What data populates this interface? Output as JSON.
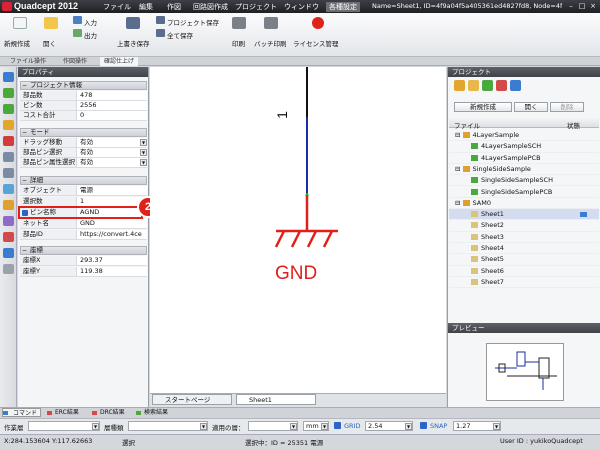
{
  "window": {
    "app_title": "Quadcept 2012",
    "menu": [
      "ファイル",
      "編集",
      "作図",
      "回路図作成",
      "プロジェクト",
      "ウィンドウ",
      "各種設定"
    ],
    "document_info": "Name=Sheet1, ID=4f9a04f5a405361ed4827fd8, Node=4f9a-..."
  },
  "ribbon": {
    "new_label": "新規作成",
    "open_label": "開く",
    "import_label": "入力",
    "export_label": "出力",
    "overwrite_save_label": "上書き保存",
    "project_save_label": "プロジェクト保存",
    "save_all_label": "全て保存",
    "print_label": "印刷",
    "batch_print_label": "バッチ印刷",
    "license_label": "ライセンス管理",
    "tabs": [
      "ファイル操作",
      "作図操作",
      "確認仕上げ"
    ]
  },
  "properties": {
    "panel_title": "プロパティ",
    "sections": {
      "project_info": "プロジェクト情報",
      "mode": "モード",
      "detail": "詳細",
      "coords": "座標"
    },
    "project_rows": [
      {
        "key": "部品数",
        "value": "478"
      },
      {
        "key": "ピン数",
        "value": "2556"
      },
      {
        "key": "コスト合計",
        "value": "0"
      }
    ],
    "mode_rows": [
      {
        "key": "ドラッグ移動",
        "value": "有効"
      },
      {
        "key": "部品ピン選択",
        "value": "有効"
      },
      {
        "key": "部品ピン属性選択",
        "value": "有効"
      }
    ],
    "detail_rows": [
      {
        "key": "オブジェクト",
        "value": "電源"
      },
      {
        "key": "選択数",
        "value": "1"
      },
      {
        "key": "ピン名称",
        "value": "AGND"
      },
      {
        "key": "ネット名",
        "value": "GND"
      },
      {
        "key": "部品ID",
        "value": "https://convert.4ce"
      }
    ],
    "coord_rows": [
      {
        "key": "座標X",
        "value": "293.37"
      },
      {
        "key": "座標Y",
        "value": "119.38"
      }
    ],
    "callout_number": "2"
  },
  "canvas": {
    "pin_number": "1",
    "net_label": "GND",
    "doc_tabs": [
      "スタートページ",
      "Sheet1"
    ]
  },
  "project": {
    "panel_title": "プロジェクト",
    "new_button": "新規作成",
    "open_button": "開く",
    "delete_button": "削除",
    "col_file": "ファイル",
    "col_status": "状態",
    "tree": [
      {
        "label": "4LayerSample",
        "level": 0,
        "kind": "project"
      },
      {
        "label": "4LayerSampleSCH",
        "level": 1,
        "kind": "sch"
      },
      {
        "label": "4LayerSamplePCB",
        "level": 1,
        "kind": "pcb"
      },
      {
        "label": "SingleSideSample",
        "level": 0,
        "kind": "project"
      },
      {
        "label": "SingleSideSampleSCH",
        "level": 1,
        "kind": "sch"
      },
      {
        "label": "SingleSideSamplePCB",
        "level": 1,
        "kind": "pcb"
      },
      {
        "label": "SAM0",
        "level": 0,
        "kind": "project"
      },
      {
        "label": "Sheet1",
        "level": 1,
        "kind": "sheet"
      },
      {
        "label": "Sheet2",
        "level": 1,
        "kind": "sheet"
      },
      {
        "label": "Sheet3",
        "level": 1,
        "kind": "sheet"
      },
      {
        "label": "Sheet4",
        "level": 1,
        "kind": "sheet"
      },
      {
        "label": "Sheet5",
        "level": 1,
        "kind": "sheet"
      },
      {
        "label": "Sheet6",
        "level": 1,
        "kind": "sheet"
      },
      {
        "label": "Sheet7",
        "level": 1,
        "kind": "sheet"
      }
    ],
    "preview_title": "プレビュー"
  },
  "bottom": {
    "tabs": [
      "コマンド",
      "ERC結果",
      "DRC結果",
      "検索結果"
    ],
    "layer_label": "作業層",
    "sublayer_label": "層種類",
    "apply_label": "適用の層：",
    "unit": "mm",
    "grid_label": "GRID",
    "grid_value": "2.54",
    "snap_label": "SNAP",
    "snap_value": "1.27"
  },
  "status": {
    "coords": "X:284.153604 Y:117.62663",
    "mode": "選択",
    "selection": "選択中：ID = 25351 電源",
    "user": "User ID : yukikoQuadcept"
  },
  "colors": {
    "accent_red": "#e0201a",
    "wire_blue": "#1a2fa0"
  }
}
